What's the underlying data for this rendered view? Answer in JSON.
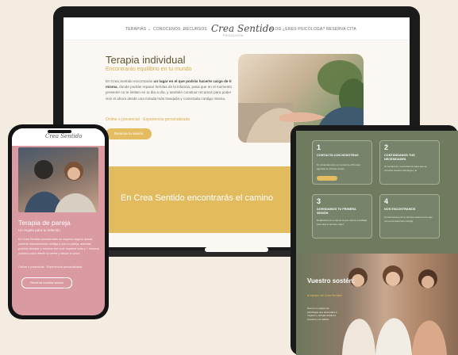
{
  "laptop": {
    "nav": {
      "items": [
        "TERAPIAS ⌄",
        "CONOCENOS ⌄",
        "RECURSOS",
        "BLOG",
        "¿ERES PSICÓLOGA?",
        "RESERVA CITA"
      ],
      "logo": "Crea Sentido",
      "logo_sub": "PSICOLOGÍA"
    },
    "hero": {
      "title": "Terapia individual",
      "subtitle": "Encontrarás equilibrio en tu mundo",
      "p_start": "En Crea Sentido encontrarás ",
      "p_bold": "un lugar en el que podrás hacerte cargo de ti misma",
      "p_end": ", donde podrás reparar heridas de la infancia, pasa que en el momento presente no te limiten en tu día a día, y también construir recursos para poder vivir el ahora desde una mirada más tranquila y conectada contigo misma.",
      "links": "Online o presencial · Experiencia personalizada",
      "button": "Reserva tu sesión"
    },
    "band_text": "En Crea Sentido encontrarás el camino"
  },
  "phone": {
    "logo": "Crea Sentido",
    "title": "Terapia de pareja",
    "subtitle": "Un regalo para tu relación",
    "paragraph": "En Crea Sentido encontraréis un espacio seguro donde podréis reencontraros contigo y con tu pareja, además podréis abordar y resolver del cuál requiere toda y + mejorar vuestra unión desde la calma y desde el amor.",
    "links": "Online o presencial · Experiencia personalizada",
    "button": "Reserva vuestra sesión"
  },
  "tablet": {
    "cards": [
      {
        "num": "1",
        "title": "CONTACTA CON NOSOTRAS",
        "text": "Te contestaremos en menos de 24h para agendar tu primera sesión."
      },
      {
        "num": "2",
        "title": "CONTÁNDANOS TUS NECESIDADES",
        "text": "Te contamos y escuchamos para que se conozca nuestra psicóloga y tú."
      },
      {
        "num": "3",
        "title": "AGENDAMOS TU PRIMERA SESIÓN",
        "text": "Realizaremos tu cita en la que vamos a trabajar para que te sientas mejor."
      },
      {
        "num": "4",
        "title": "NOS ENCONTRAMOS",
        "text": "Comenzamos por tu primera sesión en la que nos encontraremos contigo."
      }
    ],
    "title": "Vuestro sostén:",
    "subtitle": "el equipo de Crea Sentido",
    "paragraph": "Somos un equipo de psicólogas que acompaña a mujeres y parejas desde la cercanía y la calidez."
  },
  "colors": {
    "background": "#f5ece1",
    "accent_gold": "#e2bb5f",
    "phone_pink": "#d99aa2",
    "tablet_green": "#6f7a5e"
  }
}
